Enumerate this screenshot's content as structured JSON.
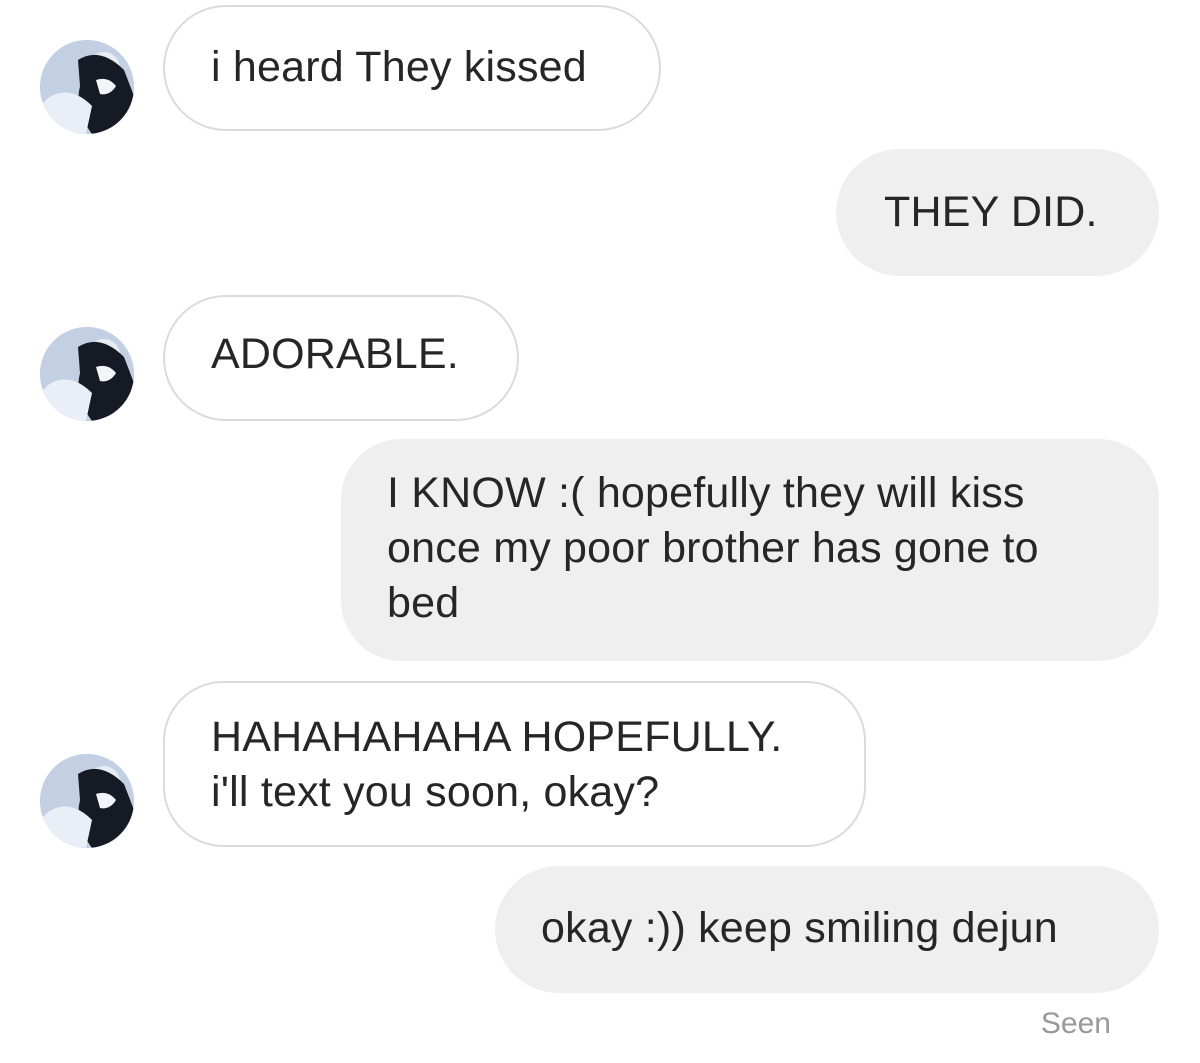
{
  "messages": [
    {
      "side": "incoming",
      "text": "i heard They kissed"
    },
    {
      "side": "outgoing",
      "text": "THEY DID."
    },
    {
      "side": "incoming",
      "text": "ADORABLE."
    },
    {
      "side": "outgoing",
      "lines": [
        "I KNOW :( hopefully they will kiss",
        "once my poor brother has gone to",
        "bed"
      ]
    },
    {
      "side": "incoming",
      "lines": [
        "HAHAHAHAHA HOPEFULLY.",
        "i'll text you soon, okay?"
      ]
    },
    {
      "side": "outgoing",
      "text": "okay :)) keep smiling dejun"
    }
  ],
  "status": {
    "seen_label": "Seen"
  },
  "avatar_icon": "contact-avatar-photo"
}
